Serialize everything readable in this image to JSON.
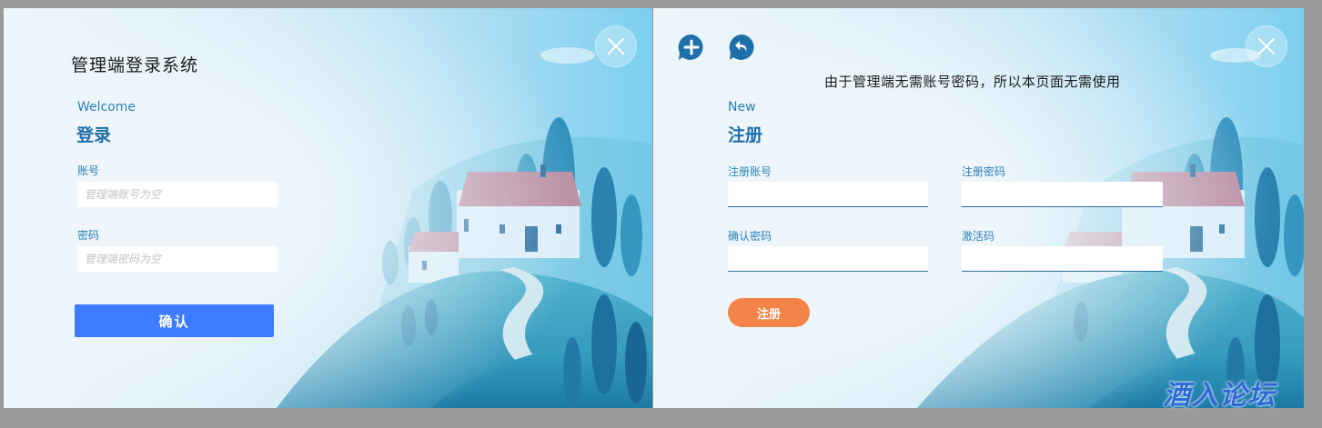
{
  "login": {
    "system_title": "管理端登录系统",
    "welcome": "Welcome",
    "heading": "登录",
    "account_label": "账号",
    "account_placeholder": "管理端账号为空",
    "password_label": "密码",
    "password_placeholder": "管理端密码为空",
    "confirm_button": "确认"
  },
  "register": {
    "notice": "由于管理端无需账号密码，所以本页面无需使用",
    "new_label": "New",
    "heading": "注册",
    "reg_account_label": "注册账号",
    "reg_password_label": "注册密码",
    "confirm_password_label": "确认密码",
    "activation_code_label": "激活码",
    "register_button": "注册"
  },
  "watermark": "酒入论坛",
  "icons": {
    "close": "close-icon",
    "add": "add-icon",
    "back": "back-icon"
  },
  "colors": {
    "confirm_button": "#3d7bff",
    "register_button": "#f4834a",
    "label_blue": "#2a7fb8",
    "heading_blue": "#1f6fa8"
  }
}
